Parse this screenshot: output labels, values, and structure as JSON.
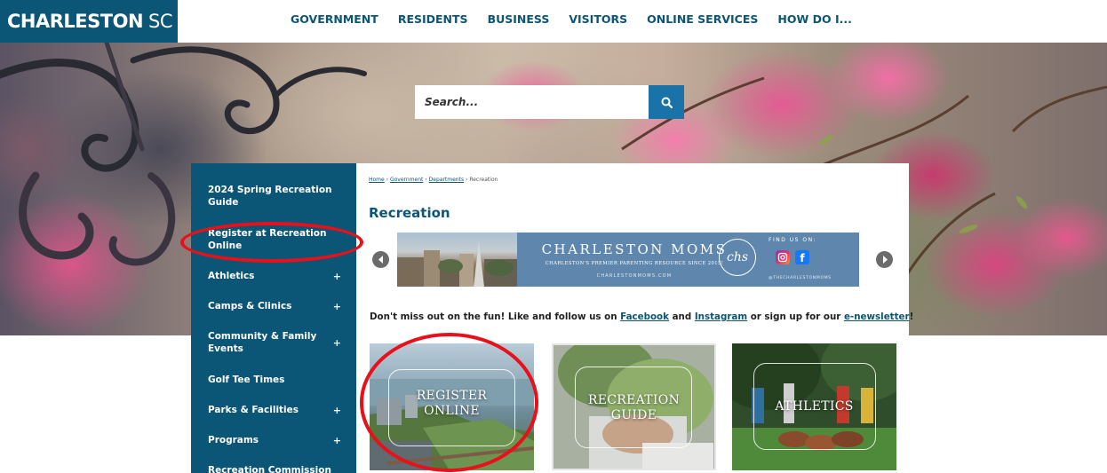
{
  "header": {
    "logo_main": "CHARLESTON",
    "logo_suffix": "SC",
    "nav": [
      "GOVERNMENT",
      "RESIDENTS",
      "BUSINESS",
      "VISITORS",
      "ONLINE SERVICES",
      "HOW DO I..."
    ]
  },
  "search": {
    "placeholder": "Search..."
  },
  "sidebar": {
    "items": [
      {
        "label": "2024 Spring Recreation Guide",
        "expandable": false
      },
      {
        "label": "Register at Recreation Online",
        "expandable": false
      },
      {
        "label": "Athletics",
        "expandable": true
      },
      {
        "label": "Camps & Clinics",
        "expandable": true
      },
      {
        "label": "Community & Family Events",
        "expandable": true
      },
      {
        "label": "Golf Tee Times",
        "expandable": false
      },
      {
        "label": "Parks & Facilities",
        "expandable": true
      },
      {
        "label": "Programs",
        "expandable": true
      },
      {
        "label": "Recreation Commission",
        "expandable": false
      }
    ],
    "plus": "+"
  },
  "breadcrumb": {
    "items": [
      "Home",
      "Government",
      "Departments"
    ],
    "current": "Recreation",
    "separator": "›"
  },
  "page_title": "Recreation",
  "banner": {
    "title": "CHARLESTON MOMS",
    "tagline": "CHARLESTON'S PREMIER PARENTING RESOURCE SINCE 2015!",
    "url": "CHARLESTONMOMS.COM",
    "logo": "chs",
    "find_us": "FIND US ON:",
    "handle": "@THECHARLESTONMOMS"
  },
  "promo": {
    "before": "Don't miss out on the fun! Like and follow us on ",
    "facebook": "Facebook",
    "mid1": " and ",
    "instagram": "Instagram",
    "mid2": " or sign up for our ",
    "newsletter": "e-newsletter",
    "end": "!"
  },
  "tiles": [
    {
      "line1": "REGISTER",
      "line2": "ONLINE"
    },
    {
      "line1": "RECREATION",
      "line2": "GUIDE"
    },
    {
      "line1": "ATHLETICS",
      "line2": ""
    }
  ],
  "colors": {
    "brand": "#0b5577",
    "search_button": "#1a73a8",
    "annotation": "#e8101b"
  }
}
